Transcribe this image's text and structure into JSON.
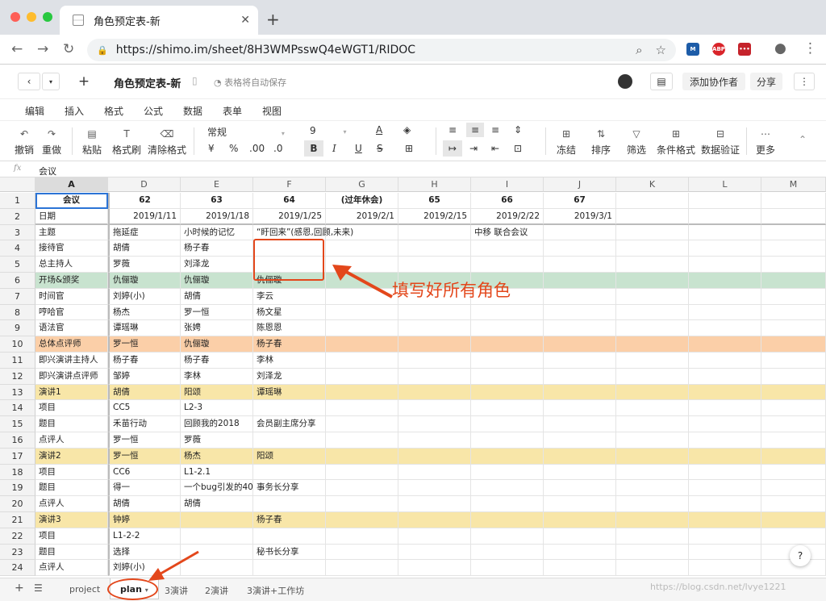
{
  "browser": {
    "tab_title": "角色预定表-新",
    "url": "https://shimo.im/sheet/8H3WMPsswQ4eWGT1/RIDOC",
    "ext1": "M",
    "ext2": "ABP",
    "ext3": "•••"
  },
  "app": {
    "title": "角色预定表-新",
    "save_status": "表格将自动保存",
    "add_collab": "添加协作者",
    "share": "分享",
    "menu": [
      "编辑",
      "插入",
      "格式",
      "公式",
      "数据",
      "表单",
      "视图"
    ]
  },
  "toolbar": {
    "undo": "撤销",
    "redo": "重做",
    "paste": "粘贴",
    "format_painter": "格式刷",
    "clear_format": "清除格式",
    "number_format": "常规",
    "font_size": "9",
    "currency": "¥",
    "percent": "%",
    "dec_inc": ".00",
    "dec_dec": ".0",
    "bold": "B",
    "italic": "I",
    "underline": "U",
    "strike": "S",
    "freeze": "冻结",
    "sort": "排序",
    "filter": "筛选",
    "cond_format": "条件格式",
    "data_valid": "数据验证",
    "more": "更多"
  },
  "formula_bar": {
    "fx": "fx",
    "value": "会议"
  },
  "grid": {
    "columns": [
      "A",
      "D",
      "E",
      "F",
      "G",
      "H",
      "I",
      "J",
      "K",
      "L",
      "M"
    ],
    "rows": [
      {
        "n": "1",
        "cells": [
          "会议",
          "62",
          "63",
          "64",
          "(过年休会)",
          "65",
          "66",
          "67",
          "",
          "",
          ""
        ],
        "bg": ""
      },
      {
        "n": "2",
        "cells": [
          "日期",
          "2019/1/11",
          "2019/1/18",
          "2019/1/25",
          "2019/2/1",
          "2019/2/15",
          "2019/2/22",
          "2019/3/1",
          "",
          "",
          ""
        ],
        "bg": ""
      },
      {
        "n": "3",
        "cells": [
          "主题",
          "拖延症",
          "小时候的记忆",
          "“盱回来”(感恩,回顾,未来)",
          "",
          "",
          "中移 联合会议",
          "",
          "",
          "",
          ""
        ],
        "bg": ""
      },
      {
        "n": "4",
        "cells": [
          "接待官",
          "胡倩",
          "杨子春",
          "",
          "",
          "",
          "",
          "",
          "",
          "",
          ""
        ],
        "bg": ""
      },
      {
        "n": "5",
        "cells": [
          "总主持人",
          "罗薇",
          "刘泽龙",
          "",
          "",
          "",
          "",
          "",
          "",
          "",
          ""
        ],
        "bg": ""
      },
      {
        "n": "6",
        "cells": [
          "开场&颁奖",
          "仇俪璇",
          "仇俪璇",
          "仇俪璇",
          "",
          "",
          "",
          "",
          "",
          "",
          ""
        ],
        "bg": "#c8e3cf"
      },
      {
        "n": "7",
        "cells": [
          "时间官",
          "刘婷(小)",
          "胡倩",
          "李云",
          "",
          "",
          "",
          "",
          "",
          "",
          ""
        ],
        "bg": ""
      },
      {
        "n": "8",
        "cells": [
          "哼哈官",
          "杨杰",
          "罗一恒",
          "杨文星",
          "",
          "",
          "",
          "",
          "",
          "",
          ""
        ],
        "bg": ""
      },
      {
        "n": "9",
        "cells": [
          "语法官",
          "谭瑶琳",
          "张娉",
          "陈恩恩",
          "",
          "",
          "",
          "",
          "",
          "",
          ""
        ],
        "bg": ""
      },
      {
        "n": "10",
        "cells": [
          "总体点评师",
          "罗一恒",
          "仇俪璇",
          "杨子春",
          "",
          "",
          "",
          "",
          "",
          "",
          ""
        ],
        "bg": "#fbcfa8"
      },
      {
        "n": "11",
        "cells": [
          "即兴演讲主持人",
          "杨子春",
          "杨子春",
          "李林",
          "",
          "",
          "",
          "",
          "",
          "",
          ""
        ],
        "bg": ""
      },
      {
        "n": "12",
        "cells": [
          "即兴演讲点评师",
          "邹婷",
          "李林",
          "刘泽龙",
          "",
          "",
          "",
          "",
          "",
          "",
          ""
        ],
        "bg": ""
      },
      {
        "n": "13",
        "cells": [
          "演讲1",
          "胡倩",
          "阳颂",
          "谭瑶琳",
          "",
          "",
          "",
          "",
          "",
          "",
          ""
        ],
        "bg": "#f8e6a8"
      },
      {
        "n": "14",
        "cells": [
          "项目",
          "CC5",
          "L2-3",
          "",
          "",
          "",
          "",
          "",
          "",
          "",
          ""
        ],
        "bg": ""
      },
      {
        "n": "15",
        "cells": [
          "题目",
          "禾苗行动",
          "回顾我的2018",
          "会员副主席分享",
          "",
          "",
          "",
          "",
          "",
          "",
          ""
        ],
        "bg": ""
      },
      {
        "n": "16",
        "cells": [
          "点评人",
          "罗一恒",
          "罗薇",
          "",
          "",
          "",
          "",
          "",
          "",
          "",
          ""
        ],
        "bg": ""
      },
      {
        "n": "17",
        "cells": [
          "演讲2",
          "罗一恒",
          "杨杰",
          "阳颂",
          "",
          "",
          "",
          "",
          "",
          "",
          ""
        ],
        "bg": "#f8e6a8"
      },
      {
        "n": "18",
        "cells": [
          "项目",
          "CC6",
          "L1-2.1",
          "",
          "",
          "",
          "",
          "",
          "",
          "",
          ""
        ],
        "bg": ""
      },
      {
        "n": "19",
        "cells": [
          "题目",
          "得一",
          "一个bug引发的40",
          "事务长分享",
          "",
          "",
          "",
          "",
          "",
          "",
          ""
        ],
        "bg": ""
      },
      {
        "n": "20",
        "cells": [
          "点评人",
          "胡倩",
          "胡倩",
          "",
          "",
          "",
          "",
          "",
          "",
          "",
          ""
        ],
        "bg": ""
      },
      {
        "n": "21",
        "cells": [
          "演讲3",
          "钟婷",
          "",
          "杨子春",
          "",
          "",
          "",
          "",
          "",
          "",
          ""
        ],
        "bg": "#f8e6a8"
      },
      {
        "n": "22",
        "cells": [
          "项目",
          "L1-2-2",
          "",
          "",
          "",
          "",
          "",
          "",
          "",
          "",
          ""
        ],
        "bg": ""
      },
      {
        "n": "23",
        "cells": [
          "题目",
          "选择",
          "",
          "秘书长分享",
          "",
          "",
          "",
          "",
          "",
          "",
          ""
        ],
        "bg": ""
      },
      {
        "n": "24",
        "cells": [
          "点评人",
          "刘婷(小)",
          "",
          "",
          "",
          "",
          "",
          "",
          "",
          "",
          ""
        ],
        "bg": ""
      }
    ]
  },
  "annotation": {
    "text": "填写好所有角色"
  },
  "sheets": [
    "project",
    "plan",
    "3演讲",
    "2演讲",
    "3演讲+工作坊"
  ],
  "watermark": "https://blog.csdn.net/lvye1221",
  "colors": {
    "accent": "#e3471b",
    "green_row": "#c8e3cf",
    "orange_row": "#fbcfa8",
    "yellow_row": "#f8e6a8"
  }
}
